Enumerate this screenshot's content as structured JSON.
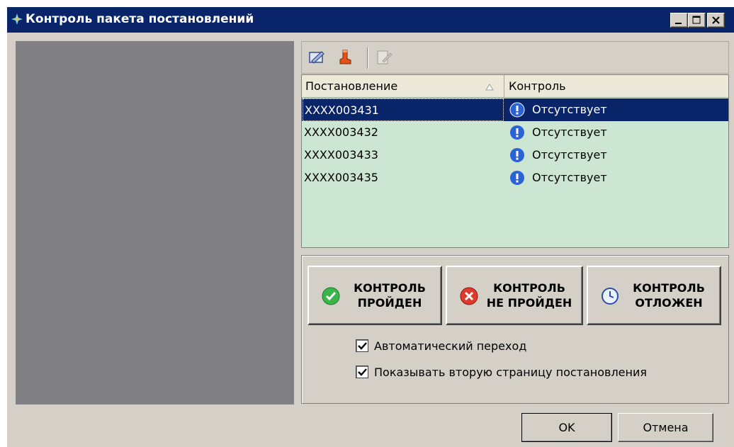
{
  "window": {
    "title": "Контроль пакета постановлений"
  },
  "toolbar": {
    "icons": [
      "edit-icon",
      "boot-icon",
      "document-disabled-icon"
    ]
  },
  "grid": {
    "columns": [
      "Постановление",
      "Контроль"
    ],
    "rows": [
      {
        "id": "XXXX003431",
        "status": "Отсутствует",
        "selected": true
      },
      {
        "id": "XXXX003432",
        "status": "Отсутствует",
        "selected": false
      },
      {
        "id": "XXXX003433",
        "status": "Отсутствует",
        "selected": false
      },
      {
        "id": "XXXX003435",
        "status": "Отсутствует",
        "selected": false
      }
    ]
  },
  "controls": {
    "passed_label": "КОНТРОЛЬ\nПРОЙДЕН",
    "failed_label": "КОНТРОЛЬ\nНЕ ПРОЙДЕН",
    "postponed_label": "КОНТРОЛЬ\nОТЛОЖЕН",
    "auto_next_label": "Автоматический переход",
    "auto_next_checked": true,
    "show_second_page_label": "Показывать вторую страницу постановления",
    "show_second_page_checked": true
  },
  "dialog": {
    "ok_label": "OK",
    "cancel_label": "Отмена"
  },
  "colors": {
    "titlebar": "#0a246a",
    "grid_bg": "#cde6d4",
    "selected_row": "#0a246a",
    "preview_bg": "#807f83",
    "dialog_bg": "#d4d0c8"
  }
}
